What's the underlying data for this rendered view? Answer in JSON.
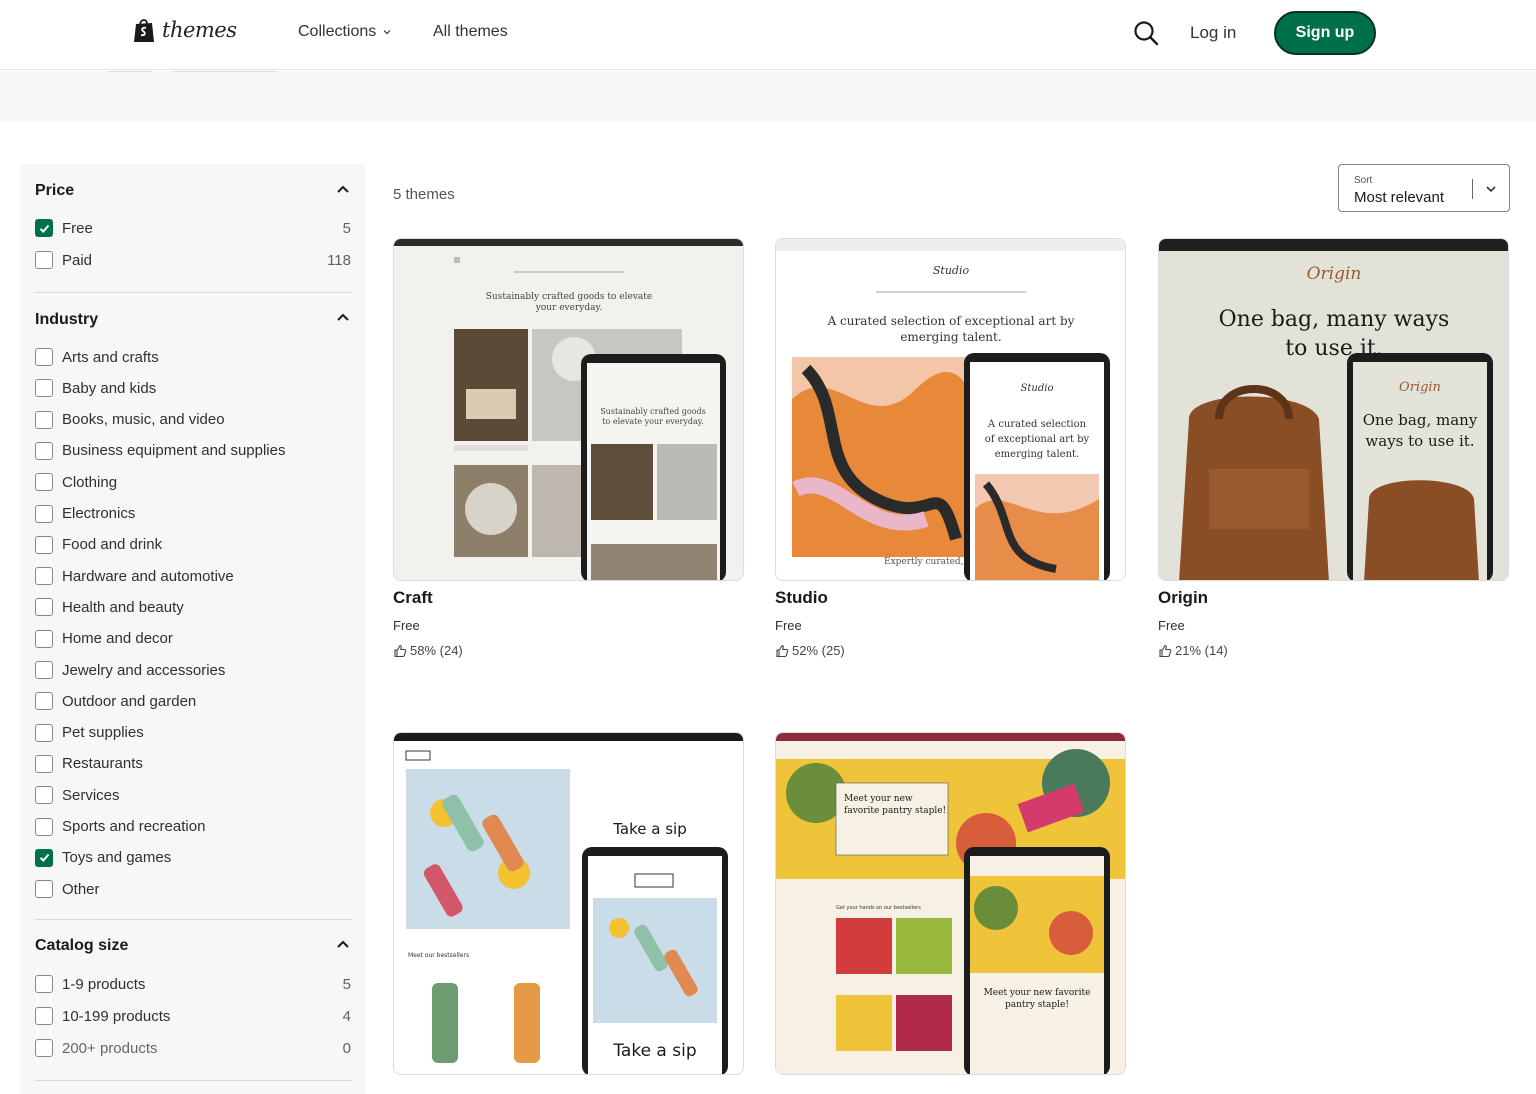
{
  "header": {
    "logo_text": "themes",
    "nav": {
      "collections": "Collections",
      "all_themes": "All themes"
    },
    "login": "Log in",
    "signup": "Sign up"
  },
  "results": {
    "count_text": "5 themes",
    "sort_label": "Sort",
    "sort_value": "Most relevant"
  },
  "filters": {
    "price": {
      "title": "Price",
      "options": [
        {
          "label": "Free",
          "count": "5",
          "checked": true
        },
        {
          "label": "Paid",
          "count": "118",
          "checked": false
        }
      ]
    },
    "industry": {
      "title": "Industry",
      "options": [
        {
          "label": "Arts and crafts",
          "checked": false
        },
        {
          "label": "Baby and kids",
          "checked": false
        },
        {
          "label": "Books, music, and video",
          "checked": false
        },
        {
          "label": "Business equipment and supplies",
          "checked": false
        },
        {
          "label": "Clothing",
          "checked": false
        },
        {
          "label": "Electronics",
          "checked": false
        },
        {
          "label": "Food and drink",
          "checked": false
        },
        {
          "label": "Hardware and automotive",
          "checked": false
        },
        {
          "label": "Health and beauty",
          "checked": false
        },
        {
          "label": "Home and decor",
          "checked": false
        },
        {
          "label": "Jewelry and accessories",
          "checked": false
        },
        {
          "label": "Outdoor and garden",
          "checked": false
        },
        {
          "label": "Pet supplies",
          "checked": false
        },
        {
          "label": "Restaurants",
          "checked": false
        },
        {
          "label": "Services",
          "checked": false
        },
        {
          "label": "Sports and recreation",
          "checked": false
        },
        {
          "label": "Toys and games",
          "checked": true
        },
        {
          "label": "Other",
          "checked": false
        }
      ]
    },
    "catalog_size": {
      "title": "Catalog size",
      "options": [
        {
          "label": "1-9 products",
          "count": "5",
          "checked": false
        },
        {
          "label": "10-199 products",
          "count": "4",
          "checked": false
        },
        {
          "label": "200+ products",
          "count": "0",
          "checked": false
        }
      ]
    }
  },
  "themes": [
    {
      "name": "Craft",
      "price": "Free",
      "rating": "58% (24)",
      "preview_headline": "Sustainably crafted goods to elevate your everyday."
    },
    {
      "name": "Studio",
      "price": "Free",
      "rating": "52% (25)",
      "preview_headline": "A curated selection of exceptional art by emerging talent."
    },
    {
      "name": "Origin",
      "price": "Free",
      "rating": "21% (14)",
      "preview_headline": "One bag, many ways to use it."
    },
    {
      "name": "",
      "price": "",
      "rating": "",
      "preview_headline": "Take a sip"
    },
    {
      "name": "",
      "price": "",
      "rating": "",
      "preview_headline": "Meet your new favorite pantry staple!"
    }
  ],
  "colors": {
    "brand_green": "#00704a",
    "sidebar_bg": "#f7f7f7",
    "checkbox_checked": "#00704a"
  },
  "icons": {
    "logo": "shopify-bag-icon",
    "search": "search-icon",
    "caret": "chevron-up-icon",
    "rating": "thumbs-up-icon"
  }
}
